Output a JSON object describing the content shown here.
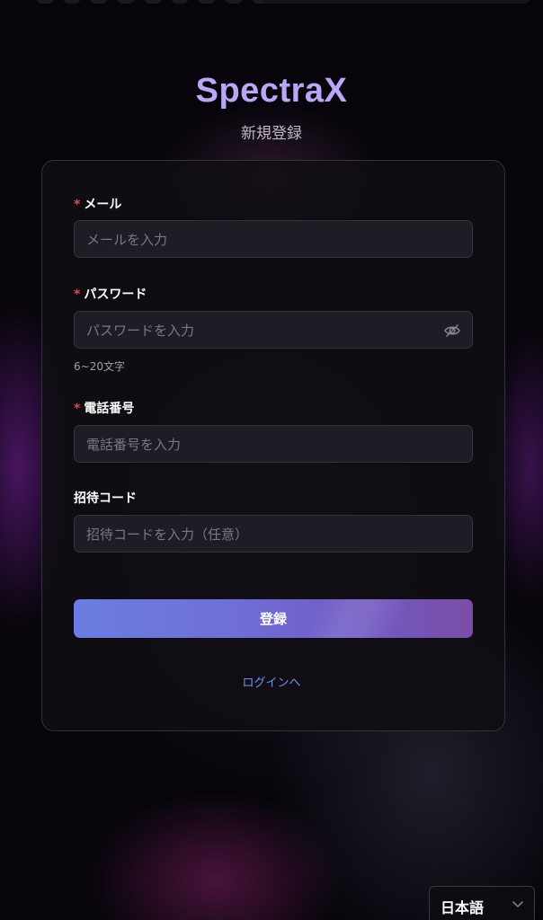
{
  "brand": {
    "name": "SpectraX",
    "color": "#b9a7f6"
  },
  "subtitle": "新規登録",
  "form": {
    "email": {
      "label": "メール",
      "required": true,
      "placeholder": "メールを入力"
    },
    "password": {
      "label": "パスワード",
      "required": true,
      "placeholder": "パスワードを入力",
      "hint": "6~20文字",
      "toggle_icon": "eye-off-icon"
    },
    "phone": {
      "label": "電話番号",
      "required": true,
      "placeholder": "電話番号を入力"
    },
    "invite": {
      "label": "招待コード",
      "required": false,
      "placeholder": "招待コードを入力（任意）"
    },
    "submit_label": "登録",
    "required_mark": "*"
  },
  "login_link": "ログインへ",
  "language": {
    "selected": "日本語",
    "icon": "chevron-down-icon"
  },
  "colors": {
    "accent_start": "#6c7de2",
    "accent_end": "#7a4ea8",
    "link": "#6f93ee",
    "required": "#e5484d"
  }
}
